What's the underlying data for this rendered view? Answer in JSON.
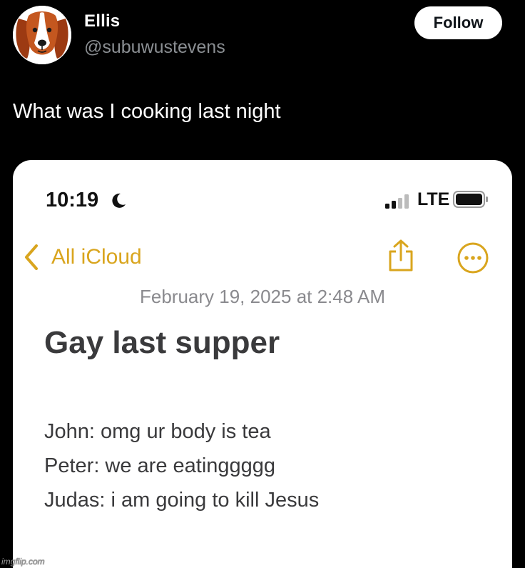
{
  "tweet": {
    "display_name": "Ellis",
    "handle": "@subuwustevens",
    "follow_label": "Follow",
    "text": "What was I cooking last night",
    "avatar_icon": "dog-avatar"
  },
  "phone_status": {
    "time": "10:19",
    "focus_icon": "moon-icon",
    "network": "LTE",
    "signal_icon": "cellular-signal-icon",
    "battery_icon": "battery-icon"
  },
  "notes_toolbar": {
    "back_label": "All iCloud",
    "share_icon": "share-icon",
    "more_icon": "more-options-icon",
    "accent_color": "#d9a51e"
  },
  "note": {
    "date": "February 19, 2025 at 2:48 AM",
    "title": "Gay last supper",
    "lines": [
      "John: omg ur body is tea",
      "Peter: we are eatinggggg",
      "Judas: i am going to kill Jesus"
    ]
  },
  "watermark": "imgflip.com"
}
